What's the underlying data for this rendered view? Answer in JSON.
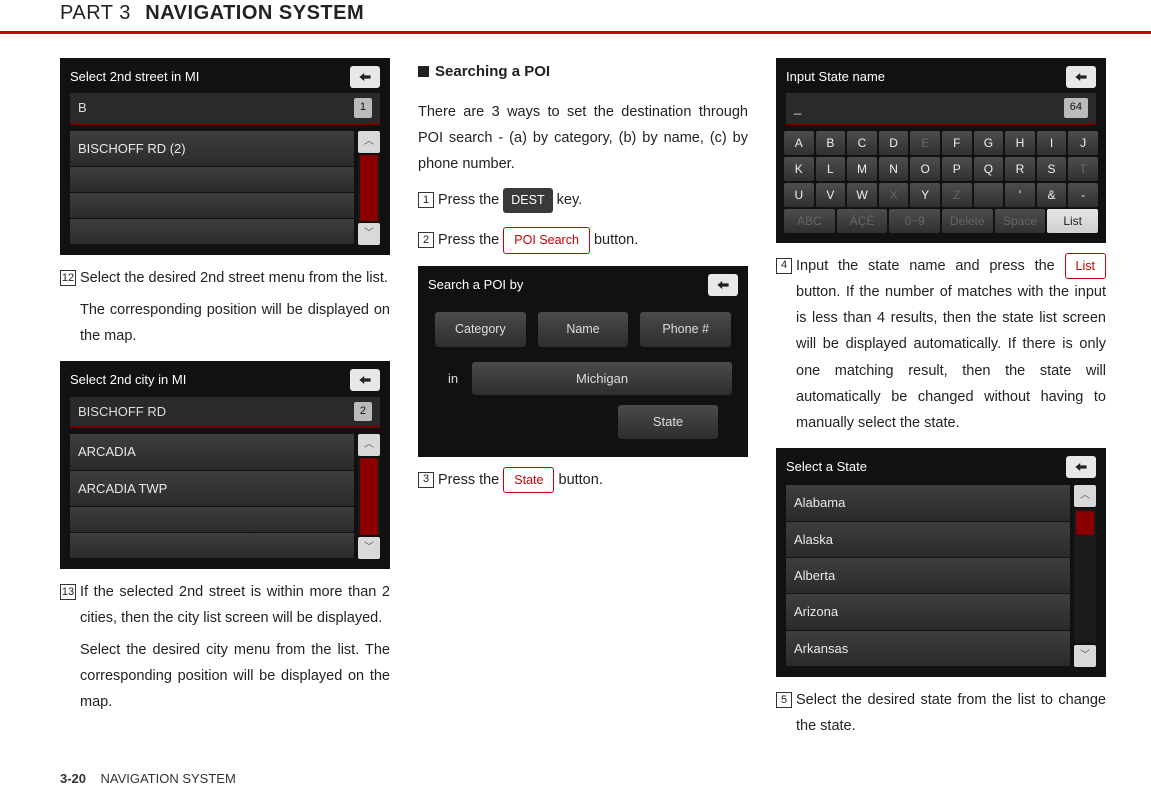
{
  "header": {
    "part": "PART 3",
    "title": "NAVIGATION SYSTEM"
  },
  "footer": {
    "page": "3-20",
    "section": "NAVIGATION SYSTEM"
  },
  "col1": {
    "screen1": {
      "title": "Select 2nd street in MI",
      "input": "B",
      "count": "1",
      "rows": [
        "BISCHOFF RD (2)"
      ]
    },
    "step12_num": "12",
    "step12": "Select the desired 2nd street menu from the list.",
    "step12b": "The corresponding position will be displayed on the map.",
    "screen2": {
      "title": "Select 2nd city in MI",
      "input": "BISCHOFF RD",
      "count": "2",
      "rows": [
        "ARCADIA",
        "ARCADIA TWP"
      ]
    },
    "step13_num": "13",
    "step13": "If the selected 2nd street is within more than 2 cities, then the city list screen will be displayed.",
    "step13b": "Select the desired city menu from the list. The corresponding position will be displayed on the map."
  },
  "col2": {
    "heading": "Searching a POI",
    "intro": "There are 3 ways to set the destination through POI search - (a) by category, (b) by name, (c) by phone number.",
    "step1_num": "1",
    "step1_a": "Press the ",
    "step1_key": "DEST",
    "step1_b": " key.",
    "step2_num": "2",
    "step2_a": "Press the ",
    "step2_btn": "POI Search",
    "step2_b": "  button.",
    "screen": {
      "title": "Search a POI by",
      "btns": [
        "Category",
        "Name",
        "Phone #"
      ],
      "in_label": "in",
      "state_bar": "Michigan",
      "state_btn": "State"
    },
    "step3_num": "3",
    "step3_a": "Press the ",
    "step3_btn": "State",
    "step3_b": " button."
  },
  "col3": {
    "screenKbd": {
      "title": "Input State name",
      "input": "_",
      "count": "64",
      "rows": [
        [
          "A",
          "B",
          "C",
          "D",
          "E",
          "F",
          "G",
          "H",
          "I",
          "J"
        ],
        [
          "K",
          "L",
          "M",
          "N",
          "O",
          "P",
          "Q",
          "R",
          "S",
          "T"
        ],
        [
          "U",
          "V",
          "W",
          "X",
          "Y",
          "Z",
          "",
          "'",
          "&",
          "-"
        ]
      ],
      "bottom": [
        "ABC",
        "ÀÇÈ",
        "0~9",
        "Delete",
        "Space",
        "List"
      ],
      "dim": [
        "E",
        "T",
        "X",
        "Z",
        "ABC",
        "ÀÇÈ",
        "0~9",
        "Delete",
        "Space"
      ]
    },
    "step4_num": "4",
    "step4_a": "Input the state name and press the ",
    "step4_btn": "List",
    "step4_b": " button. If the number of matches with the input is less than 4 results, then the state list screen will be displayed automatically. If there is only one matching result, then the state will automatically be changed without having to manually select the state.",
    "screenList": {
      "title": "Select a State",
      "rows": [
        "Alabama",
        "Alaska",
        "Alberta",
        "Arizona",
        "Arkansas"
      ]
    },
    "step5_num": "5",
    "step5": "Select the desired state from the list to change the state."
  }
}
